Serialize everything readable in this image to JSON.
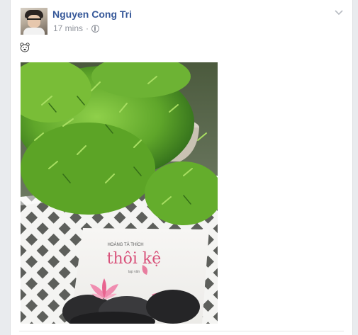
{
  "post": {
    "author": "Nguyen Cong Tri",
    "time": "17 mins",
    "separator": "·",
    "privacy_icon": "globe-icon",
    "menu_icon": "chevron-down-icon",
    "message_icon": "bear-face-emoji-icon",
    "photo": {
      "book_author": "HOÀNG TẢ THÍCH",
      "book_title": "thôi kệ",
      "book_subtitle": "tạp văn"
    }
  },
  "colors": {
    "author_link": "#365899",
    "meta_text": "#90949c",
    "page_bg": "#e9ebee",
    "plant_green": "#5fa62a"
  }
}
